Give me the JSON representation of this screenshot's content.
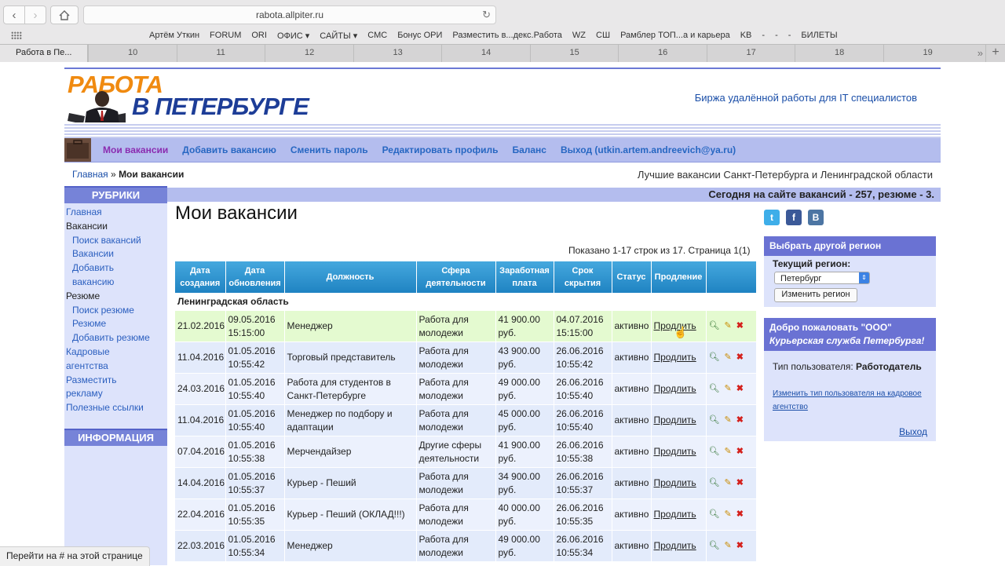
{
  "browser": {
    "url": "rabota.allpiter.ru",
    "bookmarks": [
      "Артём Уткин",
      "FORUM",
      "ORI",
      "ОФИС ▾",
      "САЙТЫ ▾",
      "СМС",
      "Бонус ОРИ",
      "Разместить в...декс.Работа",
      "WZ",
      "СШ",
      "Рамблер ТОП...а и карьера",
      "KB",
      "-",
      "-",
      "-",
      "БИЛЕТЫ"
    ],
    "active_tab": "Работа в Пе...",
    "tab_numbers": [
      "10",
      "11",
      "12",
      "13",
      "14",
      "15",
      "16",
      "17",
      "18",
      "19"
    ],
    "status_bar": "Перейти на # на этой странице"
  },
  "header": {
    "logo_line1": "РАБОТА",
    "logo_line2": "В ПЕТЕРБУРГЕ",
    "remote_link": "Биржа удалённой работы для IT специалистов"
  },
  "menu": {
    "items": [
      "Мои вакансии",
      "Добавить вакансию",
      "Сменить пароль",
      "Редактировать профиль",
      "Баланс",
      "Выход (utkin.artem.andreevich@ya.ru)"
    ]
  },
  "breadcrumb": {
    "home": "Главная",
    "separator": "»",
    "current": "Мои вакансии"
  },
  "tagline": "Лучшие вакансии Санкт-Петербурга и Ленинградской области",
  "sidebar": {
    "rubrics_title": "РУБРИКИ",
    "items": [
      "Главная",
      "Вакансии",
      "Поиск вакансий",
      "Вакансии",
      "Добавить",
      "вакансию",
      "Резюме",
      "Поиск резюме",
      "Резюме",
      "Добавить резюме",
      "Кадровые",
      "агентства",
      "Разместить",
      "рекламу",
      "Полезные ссылки"
    ],
    "info_title": "ИНФОРМАЦИЯ"
  },
  "stats": "Сегодня на сайте вакансий - 257, резюме - 3.",
  "main": {
    "title": "Мои вакансии",
    "shown": "Показано 1-17 строк из 17. Страница 1(1)",
    "columns": [
      "Дата создания",
      "Дата обновления",
      "Должность",
      "Сфера деятельности",
      "Заработная плата",
      "Срок скрытия",
      "Статус",
      "Продление",
      ""
    ],
    "region": "Ленинградская область",
    "rows": [
      {
        "created": "21.02.2016",
        "updated": "09.05.2016 15:15:00",
        "position": "Менеджер",
        "sphere": "Работа для молодежи",
        "salary": "41 900.00 руб.",
        "hide": "04.07.2016 15:15:00",
        "status": "активно",
        "prolong": "Продлить"
      },
      {
        "created": "11.04.2016",
        "updated": "01.05.2016 10:55:42",
        "position": "Торговый представитель",
        "sphere": "Работа для молодежи",
        "salary": "43 900.00 руб.",
        "hide": "26.06.2016 10:55:42",
        "status": "активно",
        "prolong": "Продлить"
      },
      {
        "created": "24.03.2016",
        "updated": "01.05.2016 10:55:40",
        "position": "Работа для студентов в Санкт-Петербурге",
        "sphere": "Работа для молодежи",
        "salary": "49 000.00 руб.",
        "hide": "26.06.2016 10:55:40",
        "status": "активно",
        "prolong": "Продлить"
      },
      {
        "created": "11.04.2016",
        "updated": "01.05.2016 10:55:40",
        "position": "Менеджер по подбору и адаптации",
        "sphere": "Работа для молодежи",
        "salary": "45 000.00 руб.",
        "hide": "26.06.2016 10:55:40",
        "status": "активно",
        "prolong": "Продлить"
      },
      {
        "created": "07.04.2016",
        "updated": "01.05.2016 10:55:38",
        "position": "Мерчендайзер",
        "sphere": "Другие сферы деятельности",
        "salary": "41 900.00 руб.",
        "hide": "26.06.2016 10:55:38",
        "status": "активно",
        "prolong": "Продлить"
      },
      {
        "created": "14.04.2016",
        "updated": "01.05.2016 10:55:37",
        "position": "Курьер - Пеший",
        "sphere": "Работа для молодежи",
        "salary": "34 900.00 руб.",
        "hide": "26.06.2016 10:55:37",
        "status": "активно",
        "prolong": "Продлить"
      },
      {
        "created": "22.04.2016",
        "updated": "01.05.2016 10:55:35",
        "position": "Курьер - Пеший (ОКЛАД!!!)",
        "sphere": "Работа для молодежи",
        "salary": "40 000.00 руб.",
        "hide": "26.06.2016 10:55:35",
        "status": "активно",
        "prolong": "Продлить"
      },
      {
        "created": "22.03.2016",
        "updated": "01.05.2016 10:55:34",
        "position": "Менеджер",
        "sphere": "Работа для молодежи",
        "salary": "49 000.00 руб.",
        "hide": "26.06.2016 10:55:34",
        "status": "активно",
        "prolong": "Продлить"
      }
    ]
  },
  "right": {
    "region_title": "Выбрать другой регион",
    "current_region_label": "Текущий регион:",
    "region_value": "Петербург",
    "change_region_button": "Изменить регион",
    "welcome_title": "Добро пожаловать \"ООО\"",
    "welcome_company": "Курьерская служба Петербурга!",
    "user_type_label": "Тип пользователя:",
    "user_type_value": "Работодатель",
    "change_type_link": "Изменить тип пользователя на кадровое агентство",
    "logout": "Выход"
  },
  "colors": {
    "accent": "#7683d8",
    "menu": "#b4bdee",
    "table_head": "#2a92cf",
    "logo_orange": "#f08a10",
    "logo_blue": "#1d3d97"
  }
}
